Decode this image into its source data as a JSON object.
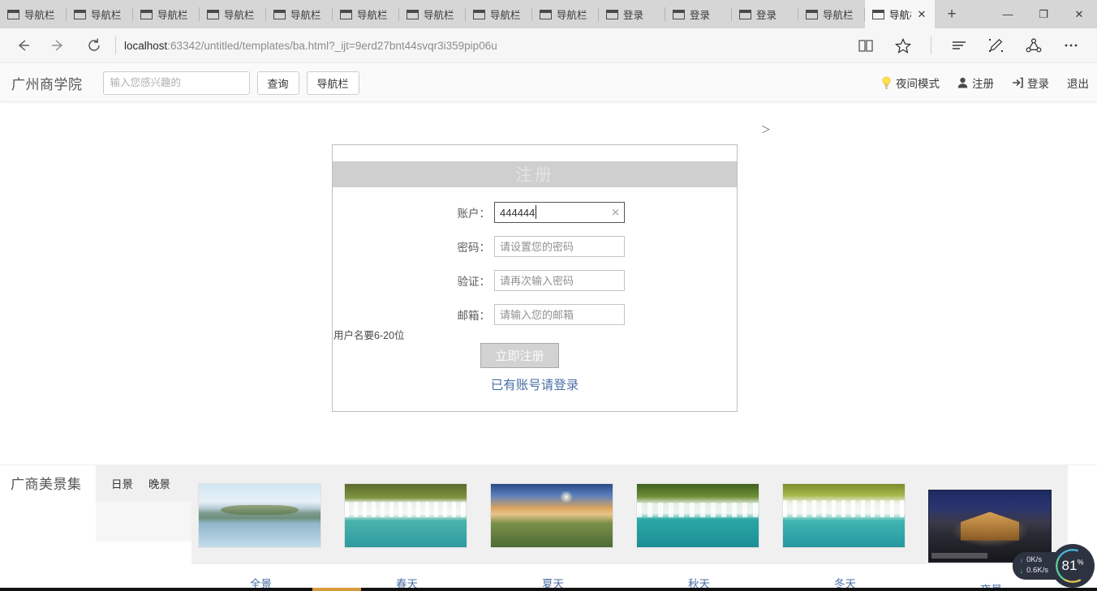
{
  "browser": {
    "tabs": [
      {
        "label": "导航栏",
        "active": false
      },
      {
        "label": "导航栏",
        "active": false
      },
      {
        "label": "导航栏",
        "active": false
      },
      {
        "label": "导航栏",
        "active": false
      },
      {
        "label": "导航栏",
        "active": false
      },
      {
        "label": "导航栏",
        "active": false
      },
      {
        "label": "导航栏",
        "active": false
      },
      {
        "label": "导航栏",
        "active": false
      },
      {
        "label": "导航栏",
        "active": false
      },
      {
        "label": "登录",
        "active": false
      },
      {
        "label": "登录",
        "active": false
      },
      {
        "label": "登录",
        "active": false
      },
      {
        "label": "导航栏",
        "active": false
      },
      {
        "label": "导航栏",
        "active": true
      }
    ],
    "new_tab_label": "+",
    "close_label": "✕",
    "window": {
      "minimize": "—",
      "maximize": "❐",
      "close": "✕"
    },
    "url": "localhost:63342/untitled/templates/ba.html?_ijt=9erd27bnt44svqr3i359pip06u",
    "url_host": "localhost",
    "url_path": ":63342/untitled/templates/ba.html?_ijt=9erd27bnt44svqr3i359pip06u"
  },
  "site_header": {
    "brand": "广州商学院",
    "search_placeholder": "输入您感兴趣的",
    "search_value": "",
    "query_button": "查询",
    "nav_button": "导航栏",
    "night_mode": "夜间模式",
    "register": "注册",
    "login": "登录",
    "logout": "退出"
  },
  "register_form": {
    "title": "注册",
    "chevron": "＞",
    "fields": [
      {
        "label": "账户：",
        "value": "444444",
        "placeholder": "",
        "focused": true,
        "clearable": true
      },
      {
        "label": "密码：",
        "value": "",
        "placeholder": "请设置您的密码",
        "focused": false,
        "clearable": false
      },
      {
        "label": "验证：",
        "value": "",
        "placeholder": "请再次输入密码",
        "focused": false,
        "clearable": false
      },
      {
        "label": "邮箱：",
        "value": "",
        "placeholder": "请输入您的邮箱",
        "focused": false,
        "clearable": false
      }
    ],
    "hint": "用户名要6-20位",
    "submit": "立即注册",
    "login_link": "已有账号请登录",
    "link_color": "#4a6fa5"
  },
  "gallery": {
    "title": "广商美景集",
    "tabs": [
      "日景",
      "晚景"
    ],
    "items": [
      {
        "caption": "全景",
        "art": "art1",
        "night": false
      },
      {
        "caption": "春天",
        "art": "art2",
        "night": false
      },
      {
        "caption": "夏天",
        "art": "art3",
        "night": false
      },
      {
        "caption": "秋天",
        "art": "art4",
        "night": false
      },
      {
        "caption": "冬天",
        "art": "art5",
        "night": false
      },
      {
        "caption": "夜景",
        "art": "art6",
        "night": true
      }
    ]
  },
  "speed_widget": {
    "upload": "0K/s",
    "download": "0.6K/s",
    "percent": "81",
    "percent_symbol": "%",
    "upload_arrow": "↑",
    "download_arrow": "↓"
  }
}
